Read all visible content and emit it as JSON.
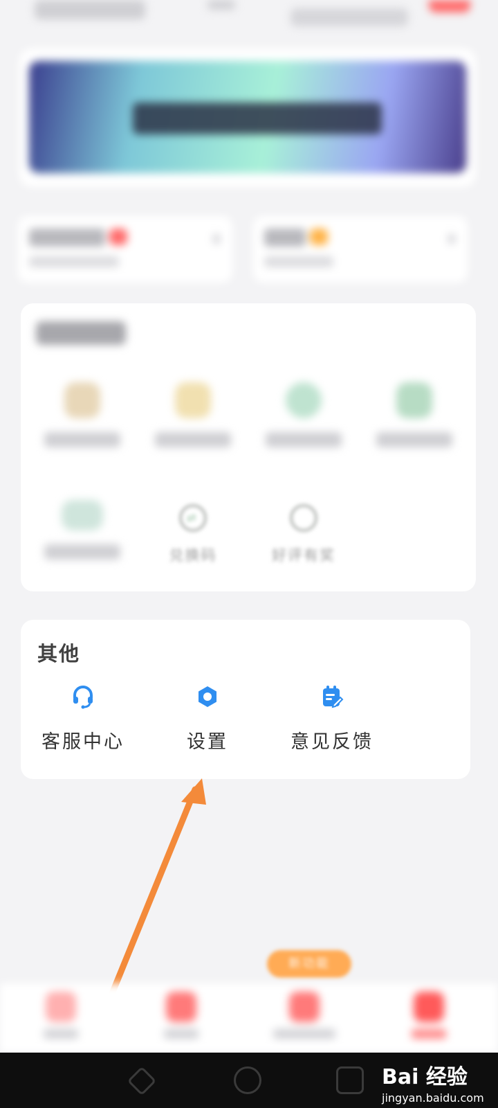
{
  "features": {
    "items": [
      {
        "label": "",
        "color": "#e8d7b8"
      },
      {
        "label": "",
        "color": "#f1e0b0"
      },
      {
        "label": "",
        "color": "#bfe3d0"
      },
      {
        "label": "",
        "color": "#b7dcc4"
      },
      {
        "label": "",
        "color": "#cfe5dc"
      },
      {
        "label": "兑换码",
        "icon": "exchange-icon"
      },
      {
        "label": "好评有奖",
        "icon": "rating-icon"
      }
    ]
  },
  "other": {
    "title": "其他",
    "items": [
      {
        "label": "客服中心",
        "icon": "headset-icon"
      },
      {
        "label": "设置",
        "icon": "gear-icon"
      },
      {
        "label": "意见反馈",
        "icon": "feedback-icon"
      }
    ]
  },
  "new_feature_badge": "新功能",
  "colors": {
    "accent_blue": "#2f8ef0",
    "arrow_orange": "#f38a3a",
    "badge_orange": "#ffab55",
    "tab_red": "#ff7a7a"
  },
  "watermark": {
    "brand": "Bai 经验",
    "url": "jingyan.baidu.com"
  }
}
